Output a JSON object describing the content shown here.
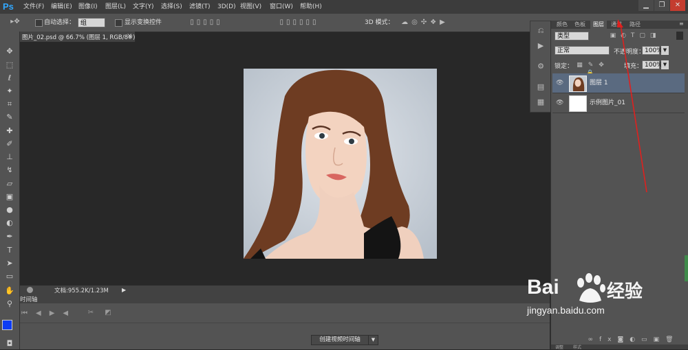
{
  "app": {
    "logo": "Ps"
  },
  "menu": [
    "文件(F)",
    "编辑(E)",
    "图像(I)",
    "图层(L)",
    "文字(Y)",
    "选择(S)",
    "滤镜(T)",
    "3D(D)",
    "视图(V)",
    "窗口(W)",
    "帮助(H)"
  ],
  "window_controls": [
    "▁",
    "❐",
    "✕"
  ],
  "options": {
    "auto_select_label": "自动选择：",
    "auto_select_value": "组",
    "show_transform_label": "显示变换控件",
    "mode_3d_label": "3D 模式："
  },
  "document": {
    "tab_title": "图片_02.psd @ 66.7% (图层 1, RGB/8#)",
    "close": "×",
    "status": "文档:955.2K/1.23M"
  },
  "timeline": {
    "tab_label": "时间轴",
    "create_button": "创建视频时间轴"
  },
  "layers_panel": {
    "tabs": [
      "颜色",
      "色板",
      "图层",
      "通道",
      "路径"
    ],
    "active_tab": "图层",
    "filter_label": "类型",
    "blend_mode": "正常",
    "opacity_label": "不透明度：",
    "opacity_value": "100%",
    "lock_label": "锁定：",
    "fill_label": "填充：",
    "fill_value": "100%",
    "layers": [
      {
        "name": "图层 1",
        "selected": true
      },
      {
        "name": "示例图片_01",
        "selected": false
      }
    ],
    "bottom_tabs": [
      "调整",
      "样式"
    ]
  },
  "watermark": {
    "brand": "Bai",
    "brand_suffix": "经验",
    "url": "jingyan.baidu.com"
  },
  "colors": {
    "foreground": "#0d3cf5",
    "background": "#ffffff",
    "annotation_arrow": "#e0201e",
    "selection": "#5a6a80"
  }
}
